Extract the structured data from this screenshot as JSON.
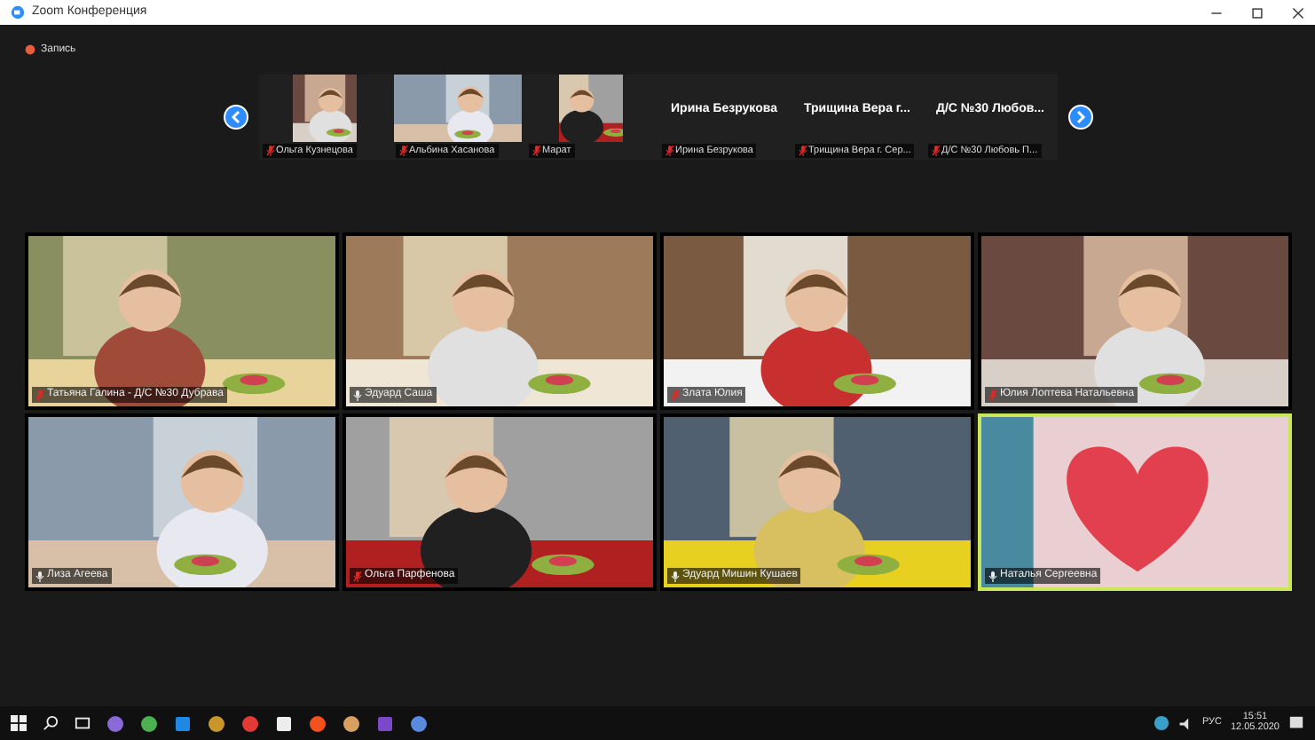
{
  "window": {
    "title": "Zoom Конференция"
  },
  "recording": {
    "label": "Запись",
    "on": true
  },
  "strip": [
    {
      "kind": "camera",
      "name": "Ольга Кузнецова",
      "muted": true
    },
    {
      "kind": "camera",
      "name": "Альбина Хасанова",
      "muted": true
    },
    {
      "kind": "camera",
      "name": "Марат",
      "muted": true
    },
    {
      "kind": "name_only",
      "display": "Ирина Безрукова",
      "name": "Ирина Безрукова",
      "muted": true
    },
    {
      "kind": "name_only",
      "display": "Трищина Вера г...",
      "name": "Трищина Вера г. Сер...",
      "muted": true
    },
    {
      "kind": "name_only",
      "display": "Д/С №30 Любов...",
      "name": "Д/С №30 Любовь П...",
      "muted": true
    }
  ],
  "tiles": [
    {
      "kind": "camera",
      "name": "Татьяна Галина - Д/С №30 Дубрава",
      "muted": true,
      "active": false
    },
    {
      "kind": "camera",
      "name": "Эдуард Саша",
      "muted": false,
      "active": false
    },
    {
      "kind": "camera",
      "name": "Злата Юлия",
      "muted": true,
      "active": false
    },
    {
      "kind": "camera",
      "name": "Юлия Лоптева Натальевна",
      "muted": true,
      "active": false
    },
    {
      "kind": "camera",
      "name": "Лиза Агеева",
      "muted": false,
      "active": false
    },
    {
      "kind": "camera",
      "name": "Ольга Парфенова",
      "muted": true,
      "active": false
    },
    {
      "kind": "camera",
      "name": "Эдуард Мишин Кушаев",
      "muted": false,
      "active": false
    },
    {
      "kind": "shared",
      "name": "Наталья Сергеевна",
      "muted": false,
      "active": true
    }
  ],
  "taskbar": {
    "language": "РУС",
    "time": "15:51",
    "date": "12.05.2020"
  }
}
